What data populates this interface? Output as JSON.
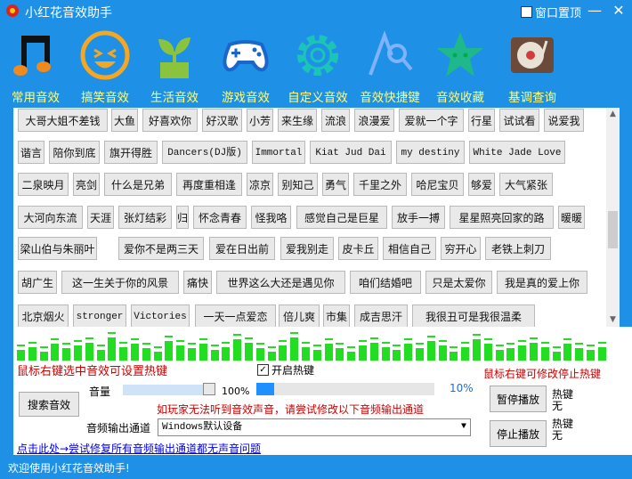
{
  "window": {
    "title": "小红花音效助手",
    "topmost_label": "窗口置顶",
    "minimize_glyph": "—",
    "close_glyph": "✕"
  },
  "nav": [
    {
      "label": "常用音效",
      "icon": "music-note-icon",
      "active": true
    },
    {
      "label": "搞笑音效",
      "icon": "laughing-face-icon"
    },
    {
      "label": "生活音效",
      "icon": "plant-pot-icon"
    },
    {
      "label": "游戏音效",
      "icon": "gamepad-icon"
    },
    {
      "label": "自定义音效",
      "icon": "gear-icon"
    },
    {
      "label": "音效快捷键",
      "icon": "search-icon"
    },
    {
      "label": "音效收藏",
      "icon": "star-icon"
    },
    {
      "label": "基调查询",
      "icon": "turntable-icon"
    }
  ],
  "sounds": [
    [
      "大哥大姐不差钱",
      "大鱼",
      "好喜欢你",
      "好汉歌",
      "小芳",
      "来生缘",
      "流浪",
      "浪漫爱",
      "爱就一个字",
      "行星",
      "试试看",
      "说爱我"
    ],
    [
      "谐言",
      "陪你到底",
      "旗开得胜",
      "Dancers(DJ版)",
      "Immortal",
      "Kiat Jud Dai",
      "my destiny",
      "White Jade Love"
    ],
    [
      "二泉映月",
      "亮剑",
      "什么是兄弟",
      "再度重相逢",
      "凉京",
      "别知己",
      "勇气",
      "千里之外",
      "哈尼宝贝",
      "够爱",
      "大气紧张"
    ],
    [
      "大河向东流",
      "天涯",
      "张灯结彩",
      "归",
      "怀念青春",
      "怪我咯",
      "感觉自己是巨星",
      "放手一搏",
      "星星照亮回家的路",
      "暖暖"
    ],
    [
      "梁山伯与朱丽叶",
      "爱你不是两三天",
      "爱在日出前",
      "爱我别走",
      "皮卡丘",
      "相信自己",
      "穷开心",
      "老铁上刺刀"
    ],
    [
      "胡广生",
      "这一生关于你的风景",
      "痛快",
      "世界这么大还是遇见你",
      "咱们结婚吧",
      "只是太爱你",
      "我是真的爱上你"
    ],
    [
      "北京烟火",
      "stronger",
      "Victories",
      "一天一点爱恋",
      "倍儿爽",
      "市集",
      "成吉思汗",
      "我很丑可是我很温柔"
    ]
  ],
  "equalizer_levels": [
    0.35,
    0.45,
    0.3,
    0.55,
    0.4,
    0.5,
    0.6,
    0.35,
    0.75,
    0.45,
    0.55,
    0.4,
    0.3,
    0.65,
    0.5,
    0.4,
    0.55,
    0.35,
    0.45,
    0.7,
    0.6,
    0.4,
    0.3,
    0.5,
    0.75,
    0.45,
    0.35,
    0.55,
    0.4,
    0.3,
    0.5,
    0.6,
    0.45,
    0.35,
    0.55,
    0.4,
    0.65,
    0.5,
    0.3,
    0.45,
    0.7,
    0.55,
    0.35,
    0.4,
    0.5,
    0.6,
    0.45,
    0.3,
    0.55,
    0.4,
    0.35,
    0.45
  ],
  "controls": {
    "hint_left": "鼠标右键选中音效可设置热键",
    "hint_right": "鼠标右键可修改停止热键",
    "hotkey_label": "开启热键",
    "hotkey_checked": true,
    "volume_label": "音量",
    "volume_value": "100%",
    "volume_level": 1.0,
    "progress_value": "10%",
    "progress_level": 0.1,
    "search_label": "搜索音效",
    "warn": "如玩家无法听到音效声音，请尝试修改以下音频输出通道",
    "output_label": "音频输出通道",
    "output_value": "Windows默认设备",
    "fix_link": "点击此处→尝试修复所有音频输出通道都无声音问题",
    "pause_label": "暂停播放",
    "stop_label": "停止播放",
    "pause_hotkey": "热键\n无",
    "stop_hotkey": "热键\n无"
  },
  "status": "欢迎使用小红花音效助手!",
  "colors": {
    "frame": "#1e90e6",
    "nav_label": "#ffff7a",
    "equalizer": "#22dd22",
    "hint": "#cc0000"
  }
}
